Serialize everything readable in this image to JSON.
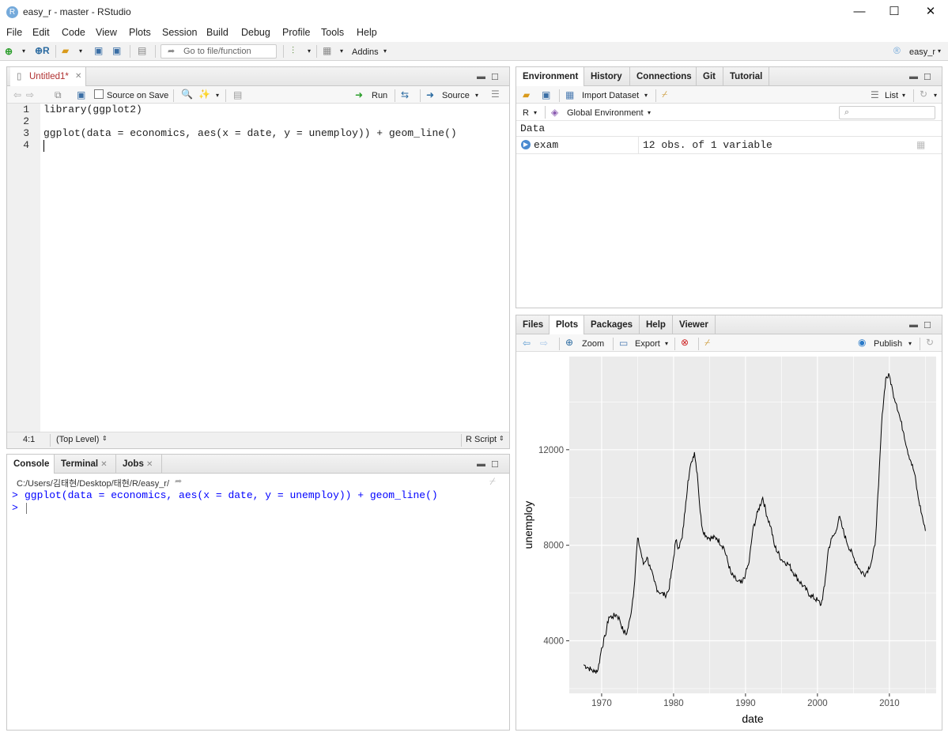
{
  "window": {
    "title": "easy_r - master - RStudio",
    "app_icon": "R",
    "minimize": "—",
    "maximize": "☐",
    "close": "✕"
  },
  "menus": [
    "File",
    "Edit",
    "Code",
    "View",
    "Plots",
    "Session",
    "Build",
    "Debug",
    "Profile",
    "Tools",
    "Help"
  ],
  "toolbar": {
    "goto_placeholder": "Go to file/function",
    "addins_label": "Addins",
    "project_label": "easy_r"
  },
  "editor": {
    "tab_label": "Untitled1*",
    "source_on_save": "Source on Save",
    "run_label": "Run",
    "source_label": "Source",
    "line_numbers": [
      "1",
      "2",
      "3",
      "4"
    ],
    "lines": {
      "l1": "library(ggplot2)",
      "l3": "ggplot(data = economics, aes(x = date, y = unemploy)) + geom_line()"
    },
    "status_position": "4:1",
    "status_scope": "(Top Level)",
    "status_type": "R Script"
  },
  "console": {
    "tabs": [
      "Console",
      "Terminal",
      "Jobs"
    ],
    "path": "C:/Users/김태현/Desktop/태현/R/easy_r/",
    "prompt": ">",
    "command": "ggplot(data = economics, aes(x = date, y = unemploy)) + geom_line()"
  },
  "environment": {
    "tabs": [
      "Environment",
      "History",
      "Connections",
      "Git",
      "Tutorial"
    ],
    "import_dataset": "Import Dataset",
    "list_label": "List",
    "r_label": "R",
    "global_env": "Global Environment",
    "section": "Data",
    "rows": [
      {
        "name": "exam",
        "value": "12 obs. of 1 variable"
      }
    ]
  },
  "files_pane": {
    "tabs": [
      "Files",
      "Plots",
      "Packages",
      "Help",
      "Viewer"
    ],
    "zoom_label": "Zoom",
    "export_label": "Export",
    "publish_label": "Publish"
  },
  "chart_data": {
    "type": "line",
    "xlabel": "date",
    "ylabel": "unemploy",
    "x_ticks": [
      "1970",
      "1980",
      "1990",
      "2000",
      "2010"
    ],
    "y_ticks": [
      "4000",
      "8000",
      "12000"
    ],
    "xlim": [
      1965.5,
      2016.5
    ],
    "ylim": [
      1800,
      15900
    ],
    "grid": true,
    "background": "#ebebeb",
    "line_color": "#000000",
    "series": [
      {
        "x": [
          1967.5,
          1968.0,
          1968.5,
          1969.0,
          1969.5,
          1970.0,
          1970.5,
          1971.0,
          1971.5,
          1972.0,
          1972.5,
          1973.0,
          1973.5,
          1974.0,
          1974.5,
          1975.0,
          1975.4,
          1975.8,
          1976.3,
          1976.8,
          1977.3,
          1977.8,
          1978.3,
          1978.8,
          1979.3,
          1979.8,
          1980.3,
          1980.7,
          1981.2,
          1981.7,
          1982.0,
          1982.5,
          1982.9,
          1983.3,
          1983.7,
          1984.0,
          1984.5,
          1985.0,
          1986.0,
          1987.0,
          1988.0,
          1988.8,
          1989.5,
          1990.0,
          1990.5,
          1991.0,
          1991.7,
          1992.4,
          1993.0,
          1993.5,
          1994.0,
          1995.0,
          1996.0,
          1997.0,
          1998.0,
          1999.0,
          2000.0,
          2000.5,
          2001.0,
          2001.5,
          2002.0,
          2002.5,
          2003.0,
          2003.5,
          2004.0,
          2005.0,
          2006.0,
          2006.7,
          2007.5,
          2008.0,
          2008.5,
          2009.0,
          2009.5,
          2010.0,
          2010.5,
          2011.0,
          2011.5,
          2012.0,
          2012.5,
          2013.0,
          2013.5,
          2014.0,
          2014.5,
          2015.0
        ],
        "y": [
          3000,
          2900,
          2800,
          2700,
          2800,
          3700,
          4200,
          5000,
          5000,
          5100,
          4900,
          4400,
          4300,
          5000,
          6200,
          8300,
          7800,
          7200,
          7500,
          7000,
          6500,
          6100,
          6000,
          5900,
          6100,
          7000,
          8200,
          7900,
          8300,
          9800,
          10700,
          11500,
          11900,
          11000,
          9400,
          8700,
          8400,
          8300,
          8300,
          7900,
          6800,
          6500,
          6400,
          6800,
          7300,
          8600,
          9400,
          10000,
          9200,
          8800,
          8000,
          7400,
          7200,
          6700,
          6300,
          5900,
          5700,
          5500,
          6300,
          7800,
          8300,
          8500,
          9200,
          8700,
          8200,
          7500,
          6900,
          6800,
          7300,
          8000,
          10500,
          13500,
          15000,
          15100,
          14400,
          13900,
          13300,
          12700,
          12000,
          11500,
          11000,
          10000,
          9300,
          8600
        ]
      }
    ]
  }
}
